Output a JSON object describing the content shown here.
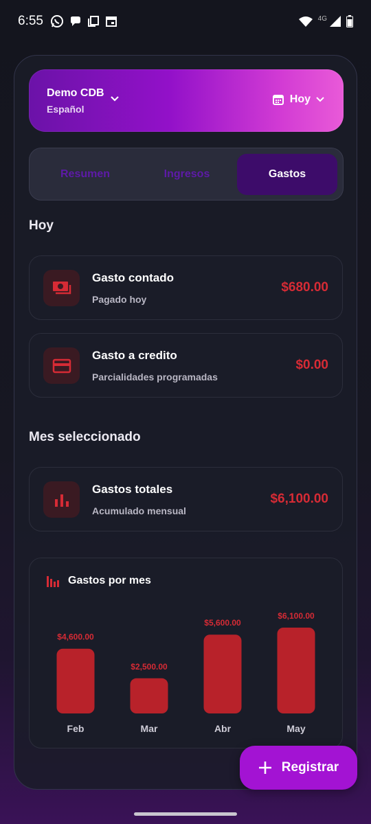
{
  "status_bar": {
    "time": "6:55",
    "network": "4G"
  },
  "header": {
    "company_name": "Demo CDB",
    "language": "Español",
    "date_filter": "Hoy"
  },
  "tabs": [
    {
      "label": "Resumen",
      "active": false
    },
    {
      "label": "Ingresos",
      "active": false
    },
    {
      "label": "Gastos",
      "active": true
    }
  ],
  "today_section": {
    "title": "Hoy",
    "cards": [
      {
        "title": "Gasto contado",
        "subtitle": "Pagado hoy",
        "value": "$680.00",
        "icon": "cash-icon"
      },
      {
        "title": "Gasto a credito",
        "subtitle": "Parcialidades programadas",
        "value": "$0.00",
        "icon": "credit-card-icon"
      }
    ]
  },
  "month_section": {
    "title": "Mes seleccionado",
    "card": {
      "title": "Gastos totales",
      "subtitle": "Acumulado mensual",
      "value": "$6,100.00",
      "icon": "bar-chart-icon"
    }
  },
  "chart_data": {
    "type": "bar",
    "title": "Gastos por mes",
    "categories": [
      "Feb",
      "Mar",
      "Abr",
      "May"
    ],
    "values": [
      4600,
      2500,
      5600,
      6100
    ],
    "value_labels": [
      "$4,600.00",
      "$2,500.00",
      "$5,600.00",
      "$6,100.00"
    ],
    "ylim": [
      0,
      6100
    ],
    "color": "#b8222a",
    "grid": false
  },
  "fab": {
    "label": "Registrar",
    "icon": "plus-icon"
  },
  "colors": {
    "accent": "#a313d3",
    "expense_red": "#d62b35",
    "bar_red": "#b8222a"
  }
}
